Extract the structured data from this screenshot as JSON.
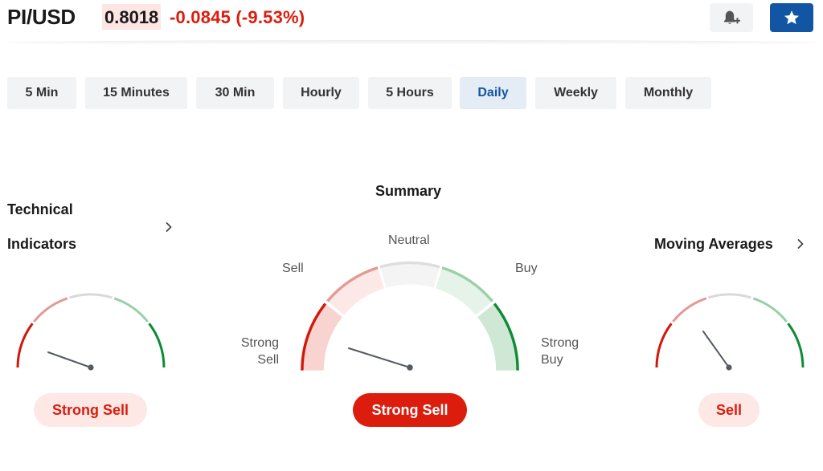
{
  "header": {
    "pair": "PI/USD",
    "price": "0.8018",
    "change": "-0.0845",
    "change_pct": "(-9.53%)",
    "bell_icon": "bell-plus-icon",
    "star_icon": "star-icon"
  },
  "timeframes": [
    "5 Min",
    "15 Minutes",
    "30 Min",
    "Hourly",
    "5 Hours",
    "Daily",
    "Weekly",
    "Monthly"
  ],
  "active_timeframe": "Daily",
  "technical": {
    "title_line1": "Technical",
    "title_line2": "Indicators",
    "verdict": "Strong Sell"
  },
  "summary": {
    "title": "Summary",
    "labels": {
      "neutral": "Neutral",
      "sell": "Sell",
      "buy": "Buy",
      "strong_sell_1": "Strong",
      "strong_sell_2": "Sell",
      "strong_buy_1": "Strong",
      "strong_buy_2": "Buy"
    },
    "verdict": "Strong Sell"
  },
  "moving_averages": {
    "title": "Moving Averages",
    "verdict": "Sell"
  },
  "colors": {
    "strong_sell": "#d0190c",
    "sell": "#e39a94",
    "neutral": "#d9d9d9",
    "buy": "#9bd0a7",
    "strong_buy": "#0e8b35",
    "accent_blue": "#1256a3",
    "negative": "#dc1c0c"
  }
}
